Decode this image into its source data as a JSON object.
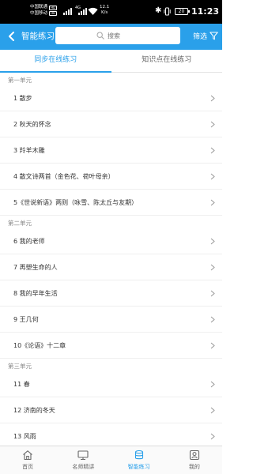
{
  "status": {
    "carrier1": "中国联通",
    "carrier2": "中国移动",
    "hd": "HD",
    "net_type": "4G",
    "speed_value": "12.1",
    "speed_unit": "K/s",
    "battery": "20",
    "time": "11:23"
  },
  "header": {
    "title": "智能练习",
    "search_placeholder": "搜索",
    "filter_label": "筛选"
  },
  "tabs": [
    {
      "label": "同步在线练习",
      "active": true
    },
    {
      "label": "知识点在线练习",
      "active": false
    }
  ],
  "units": [
    {
      "title": "第一单元",
      "lessons": [
        "1 散步",
        "2 秋天的怀念",
        "3 羚羊木雕",
        "4 散文诗两首（金色花、荷叶母亲）",
        "5《世说新语》两则（咏雪、陈太丘与友期）"
      ]
    },
    {
      "title": "第二单元",
      "lessons": [
        "6 我的老师",
        "7 再塑生命的人",
        "8 我的早年生活",
        "9 王几何",
        "10《论语》十二章"
      ]
    },
    {
      "title": "第三单元",
      "lessons": [
        "11 春",
        "12 济南的冬天",
        "13 风雨"
      ]
    }
  ],
  "bottom_nav": [
    {
      "label": "首页",
      "icon": "home-icon",
      "active": false
    },
    {
      "label": "名师精讲",
      "icon": "monitor-icon",
      "active": false
    },
    {
      "label": "智能练习",
      "icon": "stack-icon",
      "active": true
    },
    {
      "label": "我的",
      "icon": "profile-icon",
      "active": false
    }
  ],
  "colors": {
    "accent": "#2aa0ea",
    "nav_inactive": "#666666"
  }
}
